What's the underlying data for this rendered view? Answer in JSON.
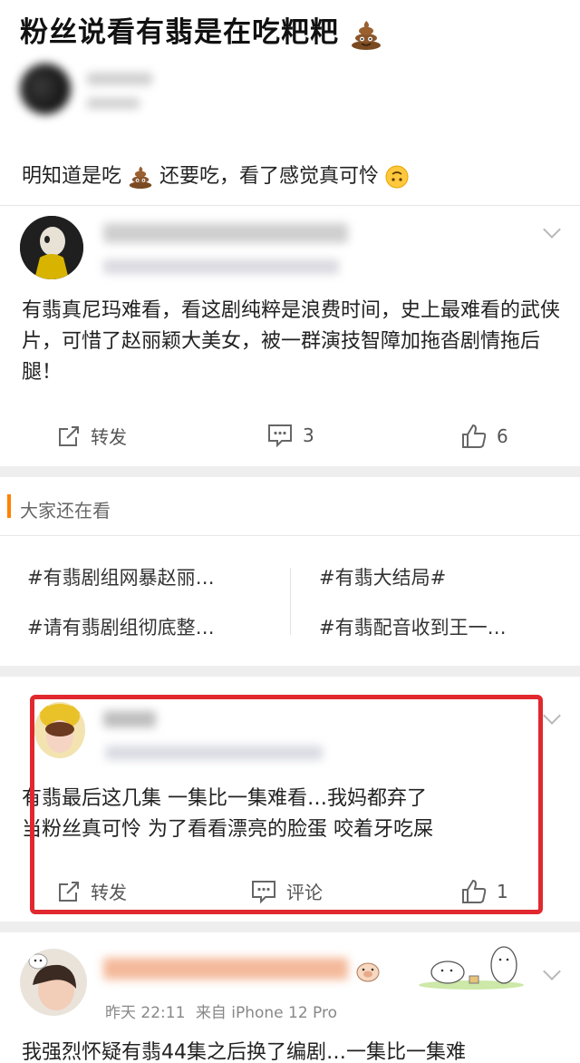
{
  "post": {
    "title": "粉丝说看有翡是在吃粑粑",
    "text_before": "明知道是吃",
    "text_after": "还要吃，看了感觉真可怜"
  },
  "comments": [
    {
      "text": "有翡真尼玛难看，看这剧纯粹是浪费时间，史上最难看的武侠片，可惜了赵丽颖大美女，被一群演技智障加拖沓剧情拖后腿！",
      "repost_label": "转发",
      "comment_count": "3",
      "like_count": "6"
    },
    {
      "text_line1": "有翡最后这几集 一集比一集难看…我妈都弃了",
      "text_line2": "当粉丝真可怜 为了看看漂亮的脸蛋 咬着牙吃屎",
      "repost_label": "转发",
      "comment_label": "评论",
      "like_count": "1"
    },
    {
      "time": "昨天 22:11",
      "source": "来自 iPhone 12 Pro",
      "text": "我强烈怀疑有翡44集之后换了编剧…一集比一集难"
    }
  ],
  "recommend": {
    "title": "大家还在看",
    "topics": [
      "#有翡剧组网暴赵丽…",
      "#有翡大结局#",
      "#请有翡剧组彻底整…",
      "#有翡配音收到王一…"
    ]
  },
  "colors": {
    "accent_orange": "#ff8200",
    "highlight_red": "#e0282e",
    "divider_gray": "#eeeeef"
  }
}
